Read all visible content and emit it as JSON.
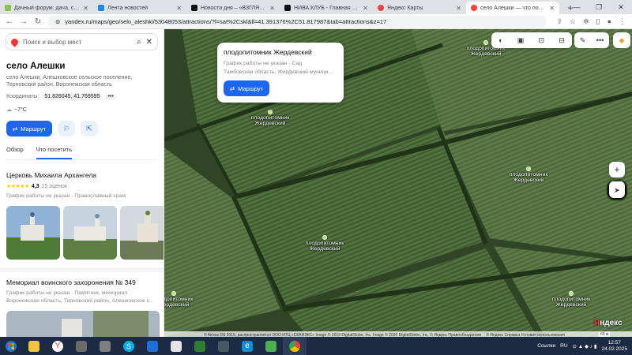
{
  "browser": {
    "tabs": [
      {
        "title": "Дачный форум: дача, сад, огор",
        "color": "#8bc34a",
        "active": false
      },
      {
        "title": "Лента новостей",
        "color": "#1e88e5",
        "active": false
      },
      {
        "title": "Новости дня – «ВЗГЛЯД.РУ»",
        "color": "#111111",
        "active": false
      },
      {
        "title": "НИВА.КЛУБ - Главная страни",
        "color": "#111111",
        "active": false
      },
      {
        "title": "Яндекс Карты",
        "color": "#f44336",
        "active": false
      },
      {
        "title": "село Алешки — что посмотр",
        "color": "#f44336",
        "active": true
      }
    ],
    "newtab": "+",
    "url": "yandex.ru/maps/geo/selo_aleshki/53048053/attractions/?l=sat%2Cskl&ll=41.391376%2C51.817987&tab=attractions&z=17"
  },
  "panel": {
    "search_placeholder": "Поиск и выбор мест",
    "place_title": "село Алешки",
    "address_line1": "село Алешки, Алешковское сельское поселение,",
    "address_line2": "Терновский район, Воронежская область",
    "coords_label": "Координаты:",
    "coords_value": "51.826045, 41.769595",
    "coords_more": "•••",
    "weather": "−7°C",
    "route_label": "Маршрут",
    "tab_overview": "Обзор",
    "tab_visit": "Что посетить",
    "poi1_title": "Церковь Михаила Архангела",
    "poi1_stars": "★★★★★",
    "poi1_rating": "4,3",
    "poi1_reviews": "15 оценок",
    "poi1_meta": "График работы не указан · Православный храм",
    "poi2_title": "Мемориал воинского захоронения № 349",
    "poi2_meta1": "График работы не указан · Памятник, мемориал",
    "poi2_meta2": "Воронежская область, Терновский район, Алешковское с..."
  },
  "popup": {
    "title": "плодопитомник Жердевский",
    "line1": "График работы не указан · Сад",
    "line2": "Тамбовская область, Жердевский муници...",
    "route_label": "Маршрут"
  },
  "markers": [
    {
      "line1": "плодопитомник",
      "line2": "Жердевский"
    },
    {
      "line1": "плодопитомник",
      "line2": "Жердевский"
    },
    {
      "line1": "плодопитомник",
      "line2": "Жердевский"
    },
    {
      "line1": "плодопитомник",
      "line2": "Жердевский"
    },
    {
      "line1": "плодопитомник",
      "line2": "Жердевский"
    },
    {
      "line1": "плодопитомник",
      "line2": "Жердевский"
    }
  ],
  "map": {
    "copyright": "© Airbus DS 2015, распространяется ООО ИТЦ «СКАНЭКС» Image © 2019 DigitalGlobe, Inc. Image © 2020 DigitalGlobe, Inc. © Яндекс   Правообладатели",
    "footer_links": "© Яндекс   Справка   Условия использования",
    "scale": "60 м",
    "logo_y": "Я",
    "logo_rest": "ндекс"
  },
  "taskbar": {
    "links": "Ссылки",
    "lang": "RU",
    "time": "12:57",
    "date": "24.02.2025"
  }
}
